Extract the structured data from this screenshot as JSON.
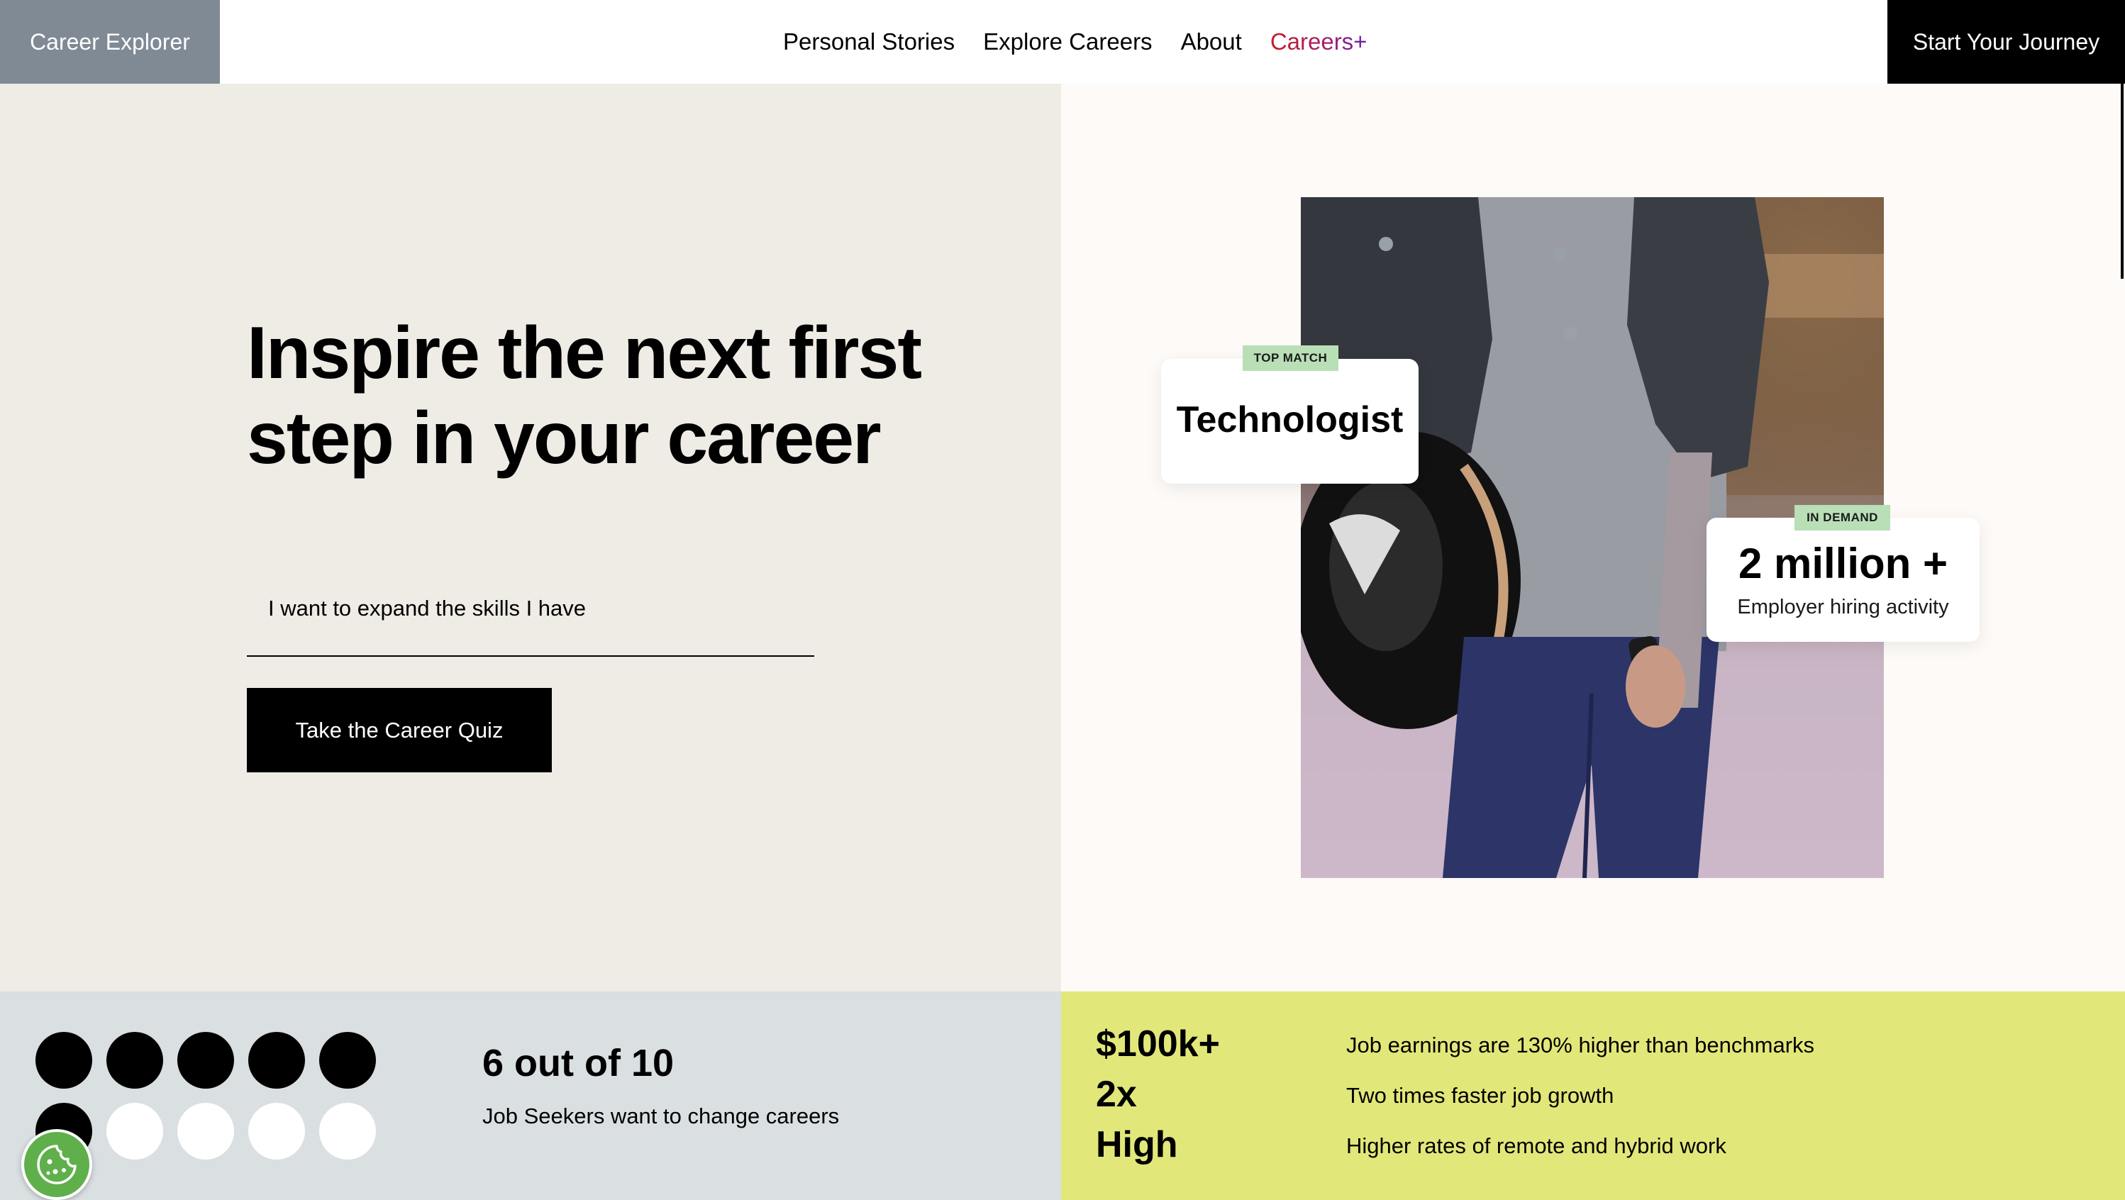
{
  "header": {
    "brand": "Career Explorer",
    "nav": [
      "Personal Stories",
      "Explore Careers",
      "About",
      "Careers+"
    ],
    "cta": "Start Your Journey"
  },
  "hero": {
    "headline": "Inspire the next first step in your career",
    "input_value": "I want to expand the skills I have",
    "button": "Take the Career Quiz"
  },
  "cards": {
    "match_tag": "TOP MATCH",
    "match_title": "Technologist",
    "demand_tag": "IN DEMAND",
    "demand_value": "2 million +",
    "demand_label": "Employer hiring activity"
  },
  "stats": {
    "dots_filled": 6,
    "dots_total": 10,
    "headline": "6 out of 10",
    "label": "Job Seekers want to change careers",
    "metrics": [
      {
        "value": "$100k+",
        "text": "Job earnings are 130% higher than benchmarks"
      },
      {
        "value": "2x",
        "text": "Two times faster job growth"
      },
      {
        "value": "High",
        "text": "Higher rates of remote and hybrid work"
      }
    ]
  },
  "icons": {
    "cookie": "cookie-icon"
  },
  "colors": {
    "brand_bg": "#7f8a95",
    "hero_left_bg": "#efebe5",
    "hero_right_bg": "#fdfaf7",
    "stats_left_bg": "#dadfe1",
    "stats_right_bg": "#e2e77a",
    "tag_bg": "#b9dfb7",
    "cookie_green": "#5fb04a"
  }
}
